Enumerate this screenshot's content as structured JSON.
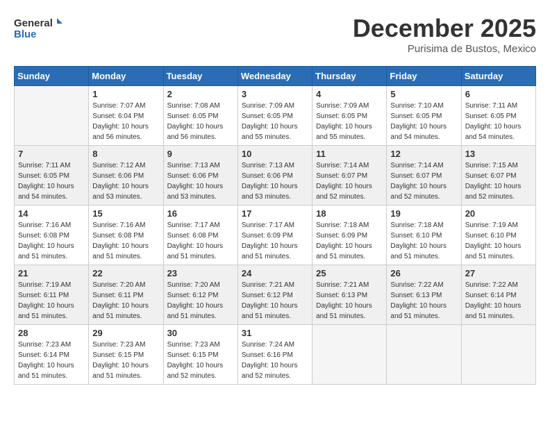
{
  "logo": {
    "line1": "General",
    "line2": "Blue"
  },
  "title": "December 2025",
  "location": "Purisima de Bustos, Mexico",
  "days_of_week": [
    "Sunday",
    "Monday",
    "Tuesday",
    "Wednesday",
    "Thursday",
    "Friday",
    "Saturday"
  ],
  "weeks": [
    [
      {
        "day": "",
        "empty": true
      },
      {
        "day": "1",
        "sunrise": "7:07 AM",
        "sunset": "6:04 PM",
        "daylight": "10 hours and 56 minutes."
      },
      {
        "day": "2",
        "sunrise": "7:08 AM",
        "sunset": "6:05 PM",
        "daylight": "10 hours and 56 minutes."
      },
      {
        "day": "3",
        "sunrise": "7:09 AM",
        "sunset": "6:05 PM",
        "daylight": "10 hours and 55 minutes."
      },
      {
        "day": "4",
        "sunrise": "7:09 AM",
        "sunset": "6:05 PM",
        "daylight": "10 hours and 55 minutes."
      },
      {
        "day": "5",
        "sunrise": "7:10 AM",
        "sunset": "6:05 PM",
        "daylight": "10 hours and 54 minutes."
      },
      {
        "day": "6",
        "sunrise": "7:11 AM",
        "sunset": "6:05 PM",
        "daylight": "10 hours and 54 minutes."
      }
    ],
    [
      {
        "day": "7",
        "sunrise": "7:11 AM",
        "sunset": "6:05 PM",
        "daylight": "10 hours and 54 minutes."
      },
      {
        "day": "8",
        "sunrise": "7:12 AM",
        "sunset": "6:06 PM",
        "daylight": "10 hours and 53 minutes."
      },
      {
        "day": "9",
        "sunrise": "7:13 AM",
        "sunset": "6:06 PM",
        "daylight": "10 hours and 53 minutes."
      },
      {
        "day": "10",
        "sunrise": "7:13 AM",
        "sunset": "6:06 PM",
        "daylight": "10 hours and 53 minutes."
      },
      {
        "day": "11",
        "sunrise": "7:14 AM",
        "sunset": "6:07 PM",
        "daylight": "10 hours and 52 minutes."
      },
      {
        "day": "12",
        "sunrise": "7:14 AM",
        "sunset": "6:07 PM",
        "daylight": "10 hours and 52 minutes."
      },
      {
        "day": "13",
        "sunrise": "7:15 AM",
        "sunset": "6:07 PM",
        "daylight": "10 hours and 52 minutes."
      }
    ],
    [
      {
        "day": "14",
        "sunrise": "7:16 AM",
        "sunset": "6:08 PM",
        "daylight": "10 hours and 51 minutes."
      },
      {
        "day": "15",
        "sunrise": "7:16 AM",
        "sunset": "6:08 PM",
        "daylight": "10 hours and 51 minutes."
      },
      {
        "day": "16",
        "sunrise": "7:17 AM",
        "sunset": "6:08 PM",
        "daylight": "10 hours and 51 minutes."
      },
      {
        "day": "17",
        "sunrise": "7:17 AM",
        "sunset": "6:09 PM",
        "daylight": "10 hours and 51 minutes."
      },
      {
        "day": "18",
        "sunrise": "7:18 AM",
        "sunset": "6:09 PM",
        "daylight": "10 hours and 51 minutes."
      },
      {
        "day": "19",
        "sunrise": "7:18 AM",
        "sunset": "6:10 PM",
        "daylight": "10 hours and 51 minutes."
      },
      {
        "day": "20",
        "sunrise": "7:19 AM",
        "sunset": "6:10 PM",
        "daylight": "10 hours and 51 minutes."
      }
    ],
    [
      {
        "day": "21",
        "sunrise": "7:19 AM",
        "sunset": "6:11 PM",
        "daylight": "10 hours and 51 minutes."
      },
      {
        "day": "22",
        "sunrise": "7:20 AM",
        "sunset": "6:11 PM",
        "daylight": "10 hours and 51 minutes."
      },
      {
        "day": "23",
        "sunrise": "7:20 AM",
        "sunset": "6:12 PM",
        "daylight": "10 hours and 51 minutes."
      },
      {
        "day": "24",
        "sunrise": "7:21 AM",
        "sunset": "6:12 PM",
        "daylight": "10 hours and 51 minutes."
      },
      {
        "day": "25",
        "sunrise": "7:21 AM",
        "sunset": "6:13 PM",
        "daylight": "10 hours and 51 minutes."
      },
      {
        "day": "26",
        "sunrise": "7:22 AM",
        "sunset": "6:13 PM",
        "daylight": "10 hours and 51 minutes."
      },
      {
        "day": "27",
        "sunrise": "7:22 AM",
        "sunset": "6:14 PM",
        "daylight": "10 hours and 51 minutes."
      }
    ],
    [
      {
        "day": "28",
        "sunrise": "7:23 AM",
        "sunset": "6:14 PM",
        "daylight": "10 hours and 51 minutes."
      },
      {
        "day": "29",
        "sunrise": "7:23 AM",
        "sunset": "6:15 PM",
        "daylight": "10 hours and 51 minutes."
      },
      {
        "day": "30",
        "sunrise": "7:23 AM",
        "sunset": "6:15 PM",
        "daylight": "10 hours and 52 minutes."
      },
      {
        "day": "31",
        "sunrise": "7:24 AM",
        "sunset": "6:16 PM",
        "daylight": "10 hours and 52 minutes."
      },
      {
        "day": "",
        "empty": true
      },
      {
        "day": "",
        "empty": true
      },
      {
        "day": "",
        "empty": true
      }
    ]
  ],
  "labels": {
    "sunrise": "Sunrise:",
    "sunset": "Sunset:",
    "daylight": "Daylight:"
  }
}
